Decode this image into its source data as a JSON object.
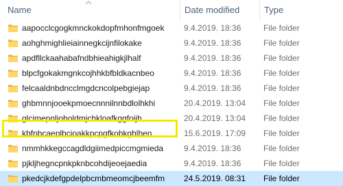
{
  "columns": {
    "name": "Name",
    "date": "Date modified",
    "type": "Type",
    "sort_icon": "chevron-up-icon"
  },
  "rows": [
    {
      "name": "aapocclcgogkmnckokdopfmhonfmgoek",
      "date": "9.4.2019. 18:36",
      "type": "File folder",
      "icon": "folder-icon"
    },
    {
      "name": "aohghmighlieiainnegkcijnfilokake",
      "date": "9.4.2019. 18:36",
      "type": "File folder",
      "icon": "folder-icon"
    },
    {
      "name": "apdfllckaahabafndbhieahigkjlhalf",
      "date": "9.4.2019. 18:36",
      "type": "File folder",
      "icon": "folder-icon"
    },
    {
      "name": "blpcfgokakmgnkcojhhkbfbldkacnbeo",
      "date": "9.4.2019. 18:36",
      "type": "File folder",
      "icon": "folder-icon"
    },
    {
      "name": "felcaaldnbdncclmgdcncolpebgiejap",
      "date": "9.4.2019. 18:36",
      "type": "File folder",
      "icon": "folder-icon"
    },
    {
      "name": "ghbmnnjooekpmoecnnnilnnbdlolhkhi",
      "date": "20.4.2019. 13:04",
      "type": "File folder",
      "icon": "folder-icon"
    },
    {
      "name": "glcimepnljoholdmjchkloafkggfoijh",
      "date": "20.4.2019. 13:04",
      "type": "File folder",
      "icon": "folder-icon"
    },
    {
      "name": "kbfnbcaeplbcioakkpcpgfkobkghlhen",
      "date": "15.6.2019. 17:09",
      "type": "File folder",
      "icon": "folder-icon"
    },
    {
      "name": "nmmhkkegccagdldgiimedpiccmgmieda",
      "date": "9.4.2019. 18:36",
      "type": "File folder",
      "icon": "folder-icon"
    },
    {
      "name": "pjkljhegncpnkpknbcohdijeoejaedia",
      "date": "9.4.2019. 18:36",
      "type": "File folder",
      "icon": "folder-icon"
    },
    {
      "name": "pkedcjkdefgpdelpbcmbmeomcjbeemfm",
      "date": "24.5.2019. 08:31",
      "type": "File folder",
      "icon": "folder-icon",
      "selected": true
    }
  ],
  "colors": {
    "highlight_box": "#f5e800",
    "selected_row": "#cce8ff",
    "folder_body": "#ffd766",
    "folder_tab": "#e8b84a"
  }
}
